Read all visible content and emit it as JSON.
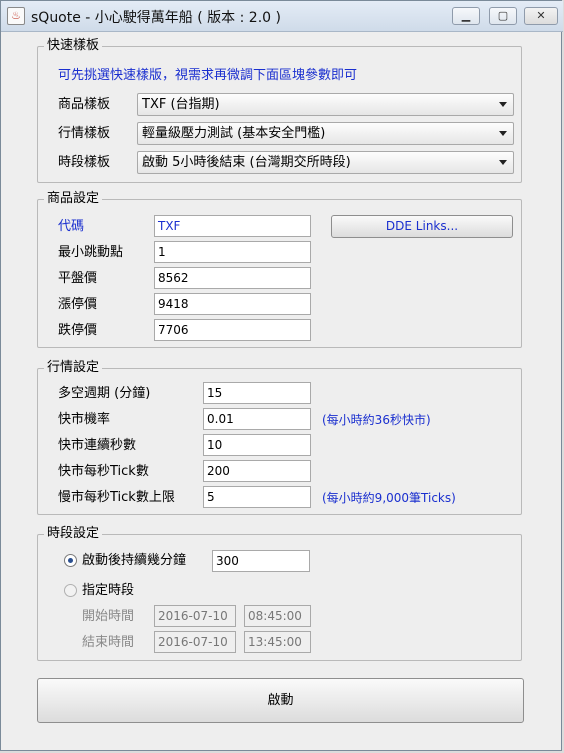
{
  "window": {
    "title": "sQuote - 小心駛得萬年船 ( 版本 : 2.0 )",
    "app_icon_glyph": "♨"
  },
  "quick_template": {
    "legend": "快速樣板",
    "hint": "可先挑選快速樣版，視需求再微調下面區塊參數即可",
    "product_label": "商品樣板",
    "product_value": "TXF (台指期)",
    "market_label": "行情樣板",
    "market_value": "輕量級壓力測試 (基本安全門檻)",
    "period_label": "時段樣板",
    "period_value": "啟動 5小時後結束 (台灣期交所時段)"
  },
  "product": {
    "legend": "商品設定",
    "code_label": "代碼",
    "code_value": "TXF",
    "tick_label": "最小跳動點",
    "tick_value": "1",
    "flat_label": "平盤價",
    "flat_value": "8562",
    "limit_up_label": "漲停價",
    "limit_up_value": "9418",
    "limit_down_label": "跌停價",
    "limit_down_value": "7706",
    "dde_button": "DDE Links..."
  },
  "market": {
    "legend": "行情設定",
    "cycle_label": "多空週期 (分鐘)",
    "cycle_value": "15",
    "fast_prob_label": "快市機率",
    "fast_prob_value": "0.01",
    "fast_prob_note": "(每小時約36秒快市)",
    "fast_secs_label": "快市連續秒數",
    "fast_secs_value": "10",
    "fast_ticks_label": "快市每秒Tick數",
    "fast_ticks_value": "200",
    "slow_ticks_label": "慢市每秒Tick數上限",
    "slow_ticks_value": "5",
    "slow_ticks_note": "(每小時約9,000筆Ticks)"
  },
  "period": {
    "legend": "時段設定",
    "option_duration_label": "啟動後持續幾分鐘",
    "duration_value": "300",
    "option_range_label": "指定時段",
    "start_label": "開始時間",
    "start_date": "2016-07-10",
    "start_time": "08:45:00",
    "end_label": "結束時間",
    "end_date": "2016-07-10",
    "end_time": "13:45:00"
  },
  "start_button": "啟動",
  "colors": {
    "label_blue": "#1a2fcf"
  }
}
